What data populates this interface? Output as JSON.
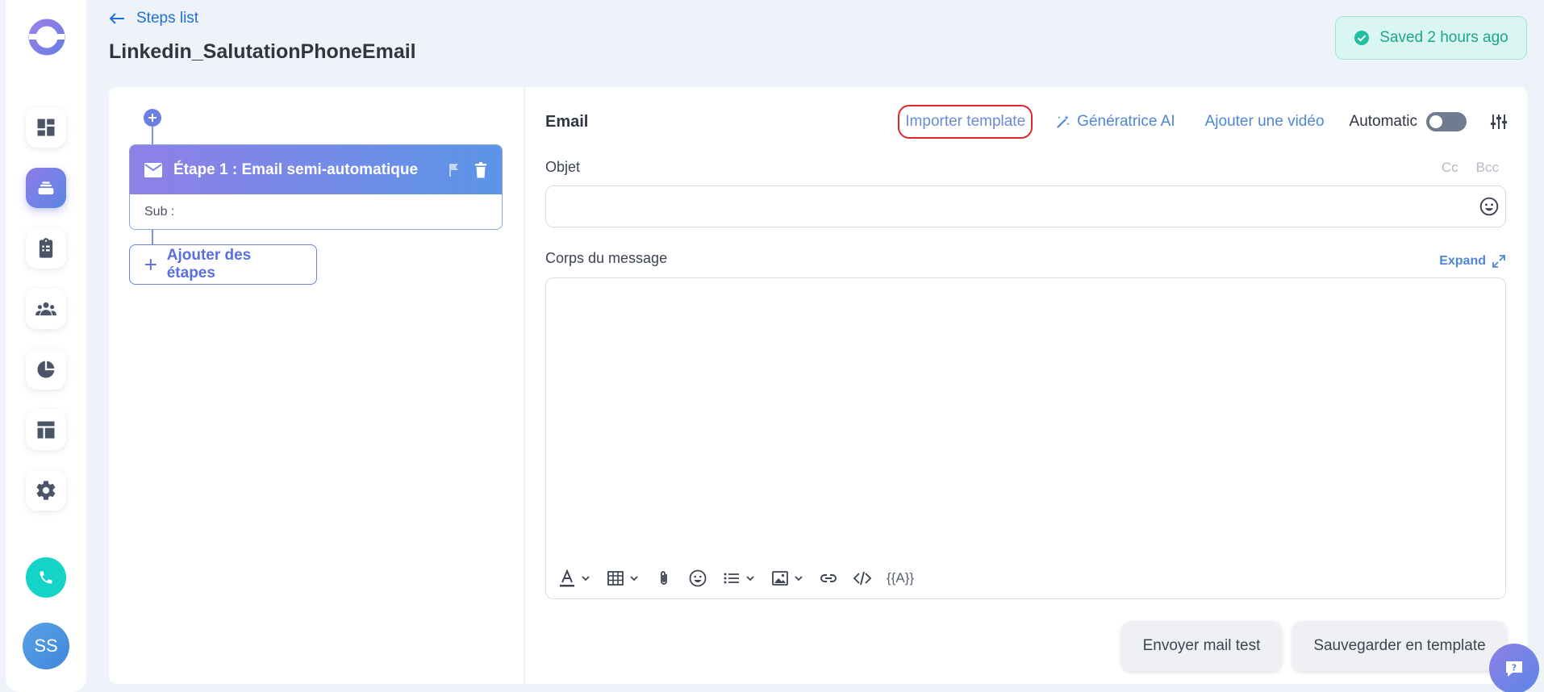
{
  "header": {
    "back_label": "Steps list",
    "title": "Linkedin_SalutationPhoneEmail",
    "saved_status": "Saved 2 hours ago"
  },
  "sidebar": {
    "items": [
      {
        "icon": "dashboard-icon"
      },
      {
        "icon": "campaigns-icon",
        "active": true
      },
      {
        "icon": "tasks-icon"
      },
      {
        "icon": "contacts-icon"
      },
      {
        "icon": "reports-icon"
      },
      {
        "icon": "templates-icon"
      },
      {
        "icon": "settings-icon"
      }
    ],
    "avatar_initials": "SS"
  },
  "steps": {
    "step1_title": "Étape 1 : Email semi-automatique",
    "step1_sub": "Sub :",
    "add_label": "Ajouter des étapes"
  },
  "editor": {
    "section_label": "Email",
    "import_template": "Importer template",
    "ai_generator": "Génératrice AI",
    "add_video": "Ajouter une vidéo",
    "automatic_label": "Automatic",
    "automatic_on": false,
    "subject_label": "Objet",
    "cc_label": "Cc",
    "bcc_label": "Bcc",
    "subject_value": "",
    "body_label": "Corps du message",
    "expand_label": "Expand",
    "variables_label": "{{A}}",
    "send_test": "Envoyer mail test",
    "save_template": "Sauvegarder en template"
  },
  "colors": {
    "accent": "#5b86e5",
    "accent_purple": "#8f7ce6",
    "saved_green": "#1ca58c",
    "highlight_red": "#e0262c"
  }
}
